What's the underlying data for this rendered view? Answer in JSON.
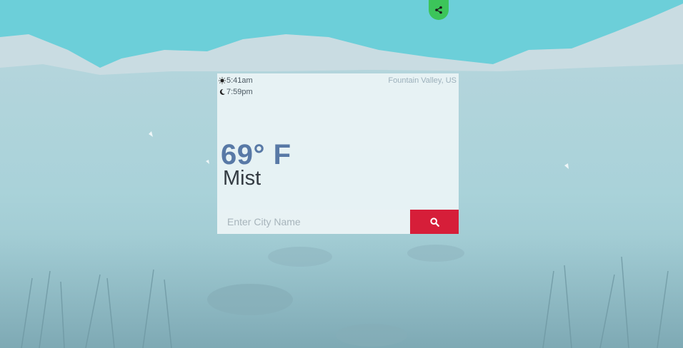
{
  "weather": {
    "sunrise": "5:41am",
    "sunset": "7:59pm",
    "location": "Fountain Valley, US",
    "temperature": "69° F",
    "condition": "Mist"
  },
  "search": {
    "placeholder": "Enter City Name"
  },
  "icons": {
    "share": "share-icon",
    "sun": "sun-icon",
    "moon": "moon-icon",
    "search": "search-icon"
  },
  "colors": {
    "sky": "#6ccfd9",
    "temperature": "#5879a6",
    "search_button": "#d61e39",
    "share_button": "#3cc55a"
  }
}
